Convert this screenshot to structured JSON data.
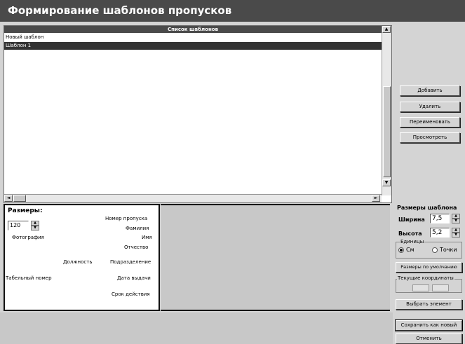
{
  "window": {
    "title": "Формирование шаблонов пропусков"
  },
  "templates_list": {
    "header": "Список шаблонов",
    "items": [
      "Новый шаблон",
      "Шаблон 1"
    ],
    "selected_index": 1
  },
  "buttons": {
    "add": "Добавить",
    "delete": "Удалить",
    "rename": "Переименовать",
    "preview": "Просмотреть",
    "default_sizes": "Размеры по умолчанию",
    "select_element": "Выбрать элемент",
    "save_as_new": "Сохранить как новый",
    "cancel": "Отменить"
  },
  "preview": {
    "sizes_label": "Размеры:",
    "size_value": "120",
    "photo_label": "Фотография",
    "fields": {
      "pass_number": "Номер пропуска",
      "last_name": "Фамилия",
      "first_name": "Имя",
      "patronymic": "Отчество",
      "position": "Должность",
      "department": "Подразделение",
      "personnel_number": "Табельный номер",
      "issue_date": "Дата выдачи",
      "validity": "Срок действия"
    }
  },
  "template_size": {
    "title": "Размеры шаблона",
    "width_label": "Ширина",
    "width_value": "7,5",
    "height_label": "Высота",
    "height_value": "5,2",
    "units_label": "Единицы",
    "unit_cm": "См",
    "unit_points": "Точки",
    "selected_unit": "cm"
  },
  "coords": {
    "label": "Текущие координаты",
    "x": "",
    "y": ""
  },
  "icons": {
    "scroll_up": "▲",
    "scroll_down": "▼",
    "scroll_left": "◄",
    "scroll_right": "►",
    "spin_up": "▲",
    "spin_down": "▼"
  }
}
